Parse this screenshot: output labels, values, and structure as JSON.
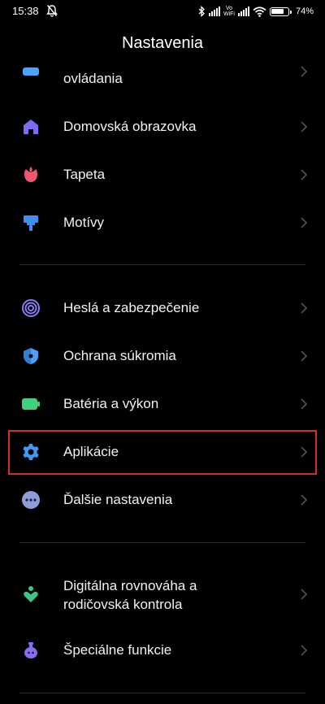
{
  "status": {
    "time": "15:38",
    "volte": "Vo\nWiFi",
    "battery_pct": "74%",
    "battery_level": 0.74
  },
  "header": {
    "title": "Nastavenia"
  },
  "items": [
    {
      "label": "ovládania",
      "icon": "rectangle-icon",
      "color": "#4aa3ff"
    },
    {
      "label": "Domovská obrazovka",
      "icon": "home-icon",
      "color": "#7d6cf2"
    },
    {
      "label": "Tapeta",
      "icon": "tulip-icon",
      "color": "#f0566e"
    },
    {
      "label": "Motívy",
      "icon": "paint-roller-icon",
      "color": "#3d8ff2"
    },
    {
      "label": "Heslá a zabezpečenie",
      "icon": "fingerprint-icon",
      "color": "#8a7af5"
    },
    {
      "label": "Ochrana súkromia",
      "icon": "privacy-shield-icon",
      "color": "#4d9ff5"
    },
    {
      "label": "Batéria a výkon",
      "icon": "battery-icon",
      "color": "#3ed27f"
    },
    {
      "label": "Aplikácie",
      "icon": "gear-icon",
      "color": "#3e9af5"
    },
    {
      "label": "Ďalšie nastavenia",
      "icon": "more-dots-icon",
      "color": "#8f9dd8"
    },
    {
      "label": "Digitálna rovnováha a rodičovská kontrola",
      "label_line1": "Digitálna rovnováha a",
      "label_line2": "rodičovská kontrola",
      "icon": "person-heart-icon",
      "color": "#3ec488"
    },
    {
      "label": "Špeciálne funkcie",
      "icon": "potion-icon",
      "color": "#8a6cf2"
    }
  ]
}
